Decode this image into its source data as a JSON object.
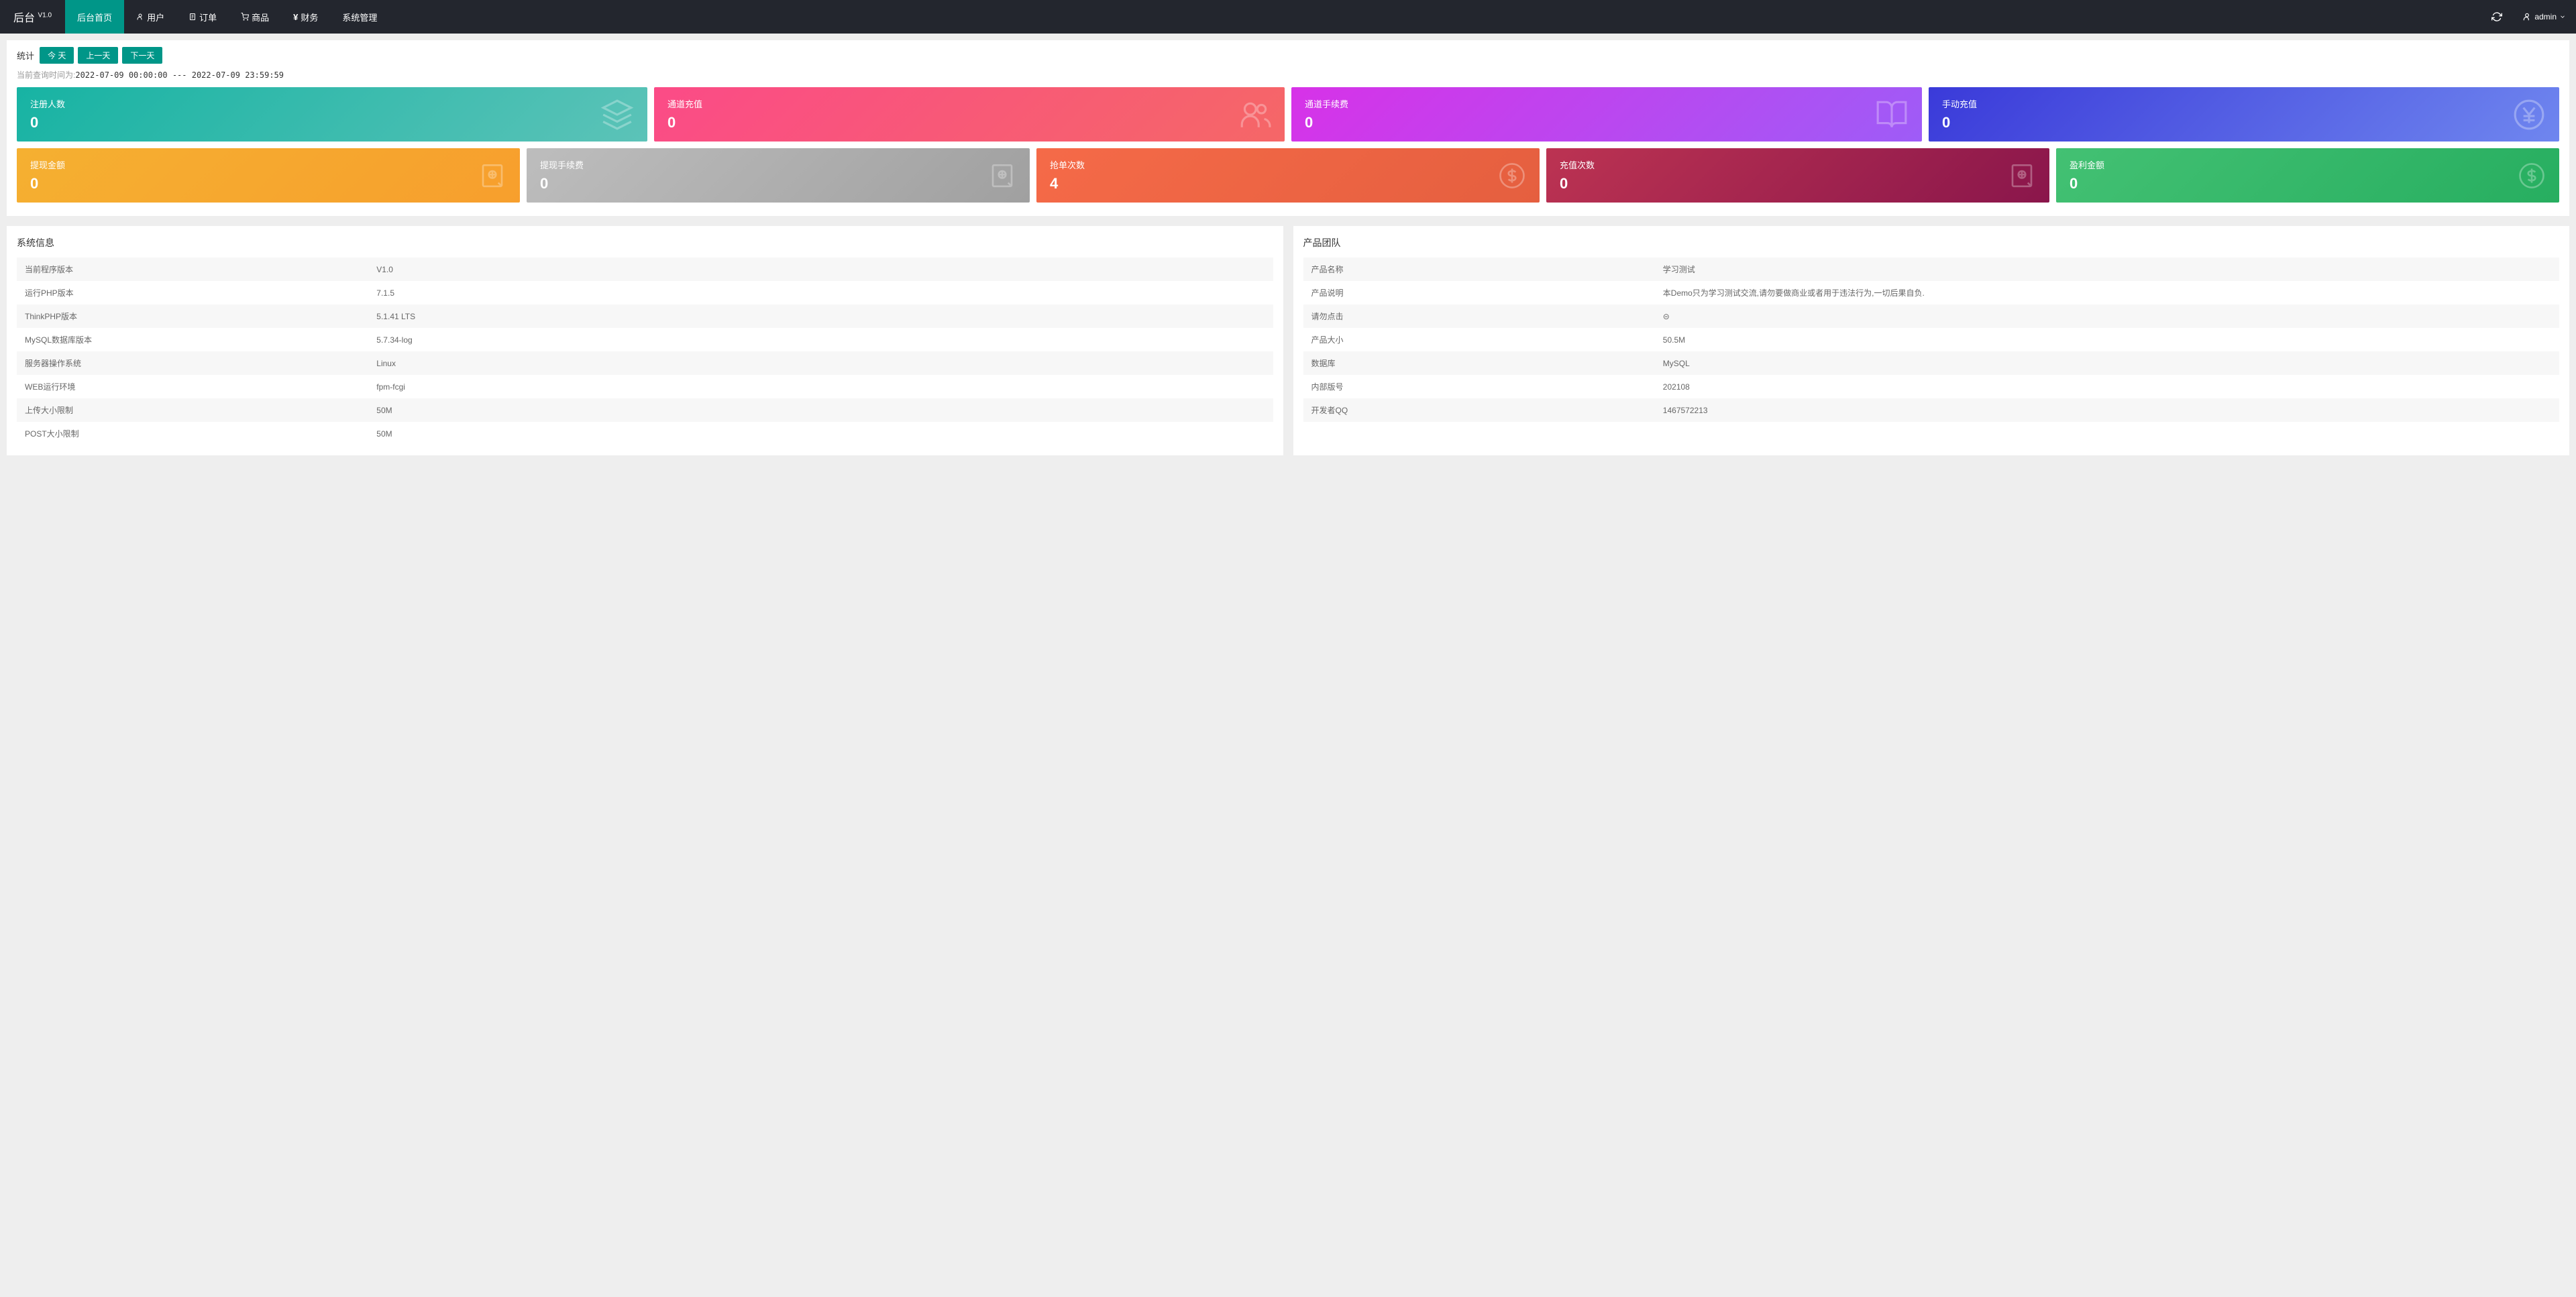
{
  "header": {
    "logo": "后台",
    "version": "V1.0",
    "nav": [
      {
        "label": "后台首页",
        "icon": ""
      },
      {
        "label": "用户",
        "icon": "user"
      },
      {
        "label": "订单",
        "icon": "order"
      },
      {
        "label": "商品",
        "icon": "cart"
      },
      {
        "label": "财务",
        "icon": "yen"
      },
      {
        "label": "系统管理",
        "icon": ""
      }
    ],
    "user": "admin"
  },
  "stats": {
    "label": "统计",
    "buttons": [
      "今 天",
      "上一天",
      "下一天"
    ],
    "time_label": "当前查询时间为:",
    "time_value": "2022-07-09 00:00:00 --- 2022-07-09 23:59:59"
  },
  "tiles_row1": [
    {
      "title": "注册人数",
      "value": "0",
      "grad": "g-teal",
      "icon": "layers"
    },
    {
      "title": "通道充值",
      "value": "0",
      "grad": "g-pink",
      "icon": "users"
    },
    {
      "title": "通道手续费",
      "value": "0",
      "grad": "g-purple",
      "icon": "book"
    },
    {
      "title": "手动充值",
      "value": "0",
      "grad": "g-indigo",
      "icon": "yen-circle"
    }
  ],
  "tiles_row2": [
    {
      "title": "提现金额",
      "value": "0",
      "grad": "g-orange",
      "icon": "note"
    },
    {
      "title": "提现手续费",
      "value": "0",
      "grad": "g-grey",
      "icon": "note"
    },
    {
      "title": "抢单次数",
      "value": "4",
      "grad": "g-red",
      "icon": "dollar"
    },
    {
      "title": "充值次数",
      "value": "0",
      "grad": "g-maroon",
      "icon": "note"
    },
    {
      "title": "盈利金额",
      "value": "0",
      "grad": "g-green",
      "icon": "dollar"
    }
  ],
  "system_info": {
    "title": "系统信息",
    "rows": [
      [
        "当前程序版本",
        "V1.0"
      ],
      [
        "运行PHP版本",
        "7.1.5"
      ],
      [
        "ThinkPHP版本",
        "5.1.41 LTS"
      ],
      [
        "MySQL数据库版本",
        "5.7.34-log"
      ],
      [
        "服务器操作系统",
        "Linux"
      ],
      [
        "WEB运行环境",
        "fpm-fcgi"
      ],
      [
        "上传大小限制",
        "50M"
      ],
      [
        "POST大小限制",
        "50M"
      ]
    ]
  },
  "product_team": {
    "title": "产品团队",
    "rows": [
      [
        "产品名称",
        "学习测试"
      ],
      [
        "产品说明",
        "本Demo只为学习测试交流,请勿要做商业或者用于违法行为,一切后果自负."
      ],
      [
        "请勿点击",
        "⊝"
      ],
      [
        "产品大小",
        "50.5M"
      ],
      [
        "数据库",
        "MySQL"
      ],
      [
        "内部版号",
        "202108"
      ],
      [
        "开发者QQ",
        "1467572213"
      ]
    ]
  }
}
